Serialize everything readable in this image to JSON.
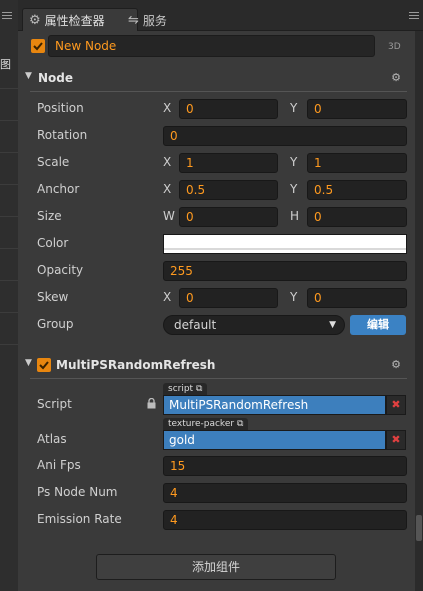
{
  "left_strip": {
    "glyph": "图"
  },
  "tabs": [
    {
      "label": "属性检查器",
      "icon": "gear-icon",
      "active": true
    },
    {
      "label": "服务",
      "icon": "link-icon",
      "active": false
    }
  ],
  "node": {
    "name": "New Node",
    "badge": "3D",
    "enabled": true
  },
  "node_section": {
    "title": "Node",
    "properties": {
      "position": {
        "label": "Position",
        "x_label": "X",
        "x": "0",
        "y_label": "Y",
        "y": "0"
      },
      "rotation": {
        "label": "Rotation",
        "value": "0"
      },
      "scale": {
        "label": "Scale",
        "x_label": "X",
        "x": "1",
        "y_label": "Y",
        "y": "1"
      },
      "anchor": {
        "label": "Anchor",
        "x_label": "X",
        "x": "0.5",
        "y_label": "Y",
        "y": "0.5"
      },
      "size": {
        "label": "Size",
        "w_label": "W",
        "w": "0",
        "h_label": "H",
        "h": "0"
      },
      "color": {
        "label": "Color",
        "value": "#ffffff"
      },
      "opacity": {
        "label": "Opacity",
        "value": "255"
      },
      "skew": {
        "label": "Skew",
        "x_label": "X",
        "x": "0",
        "y_label": "Y",
        "y": "0"
      },
      "group": {
        "label": "Group",
        "value": "default",
        "edit_button": "编辑"
      }
    }
  },
  "component": {
    "title": "MultiPSRandomRefresh",
    "enabled": true,
    "script": {
      "label": "Script",
      "tag": "script",
      "value": "MultiPSRandomRefresh"
    },
    "atlas": {
      "label": "Atlas",
      "tag": "texture-packer",
      "value": "gold"
    },
    "ani_fps": {
      "label": "Ani Fps",
      "value": "15"
    },
    "ps_node_num": {
      "label": "Ps Node Num",
      "value": "4"
    },
    "emission_rate": {
      "label": "Emission Rate",
      "value": "4"
    }
  },
  "add_component_label": "添加组件",
  "colors": {
    "accent_orange": "#e8860f",
    "value_orange": "#ff9a1f",
    "asset_blue": "#3d7fbd",
    "remove_red": "#e04040"
  }
}
